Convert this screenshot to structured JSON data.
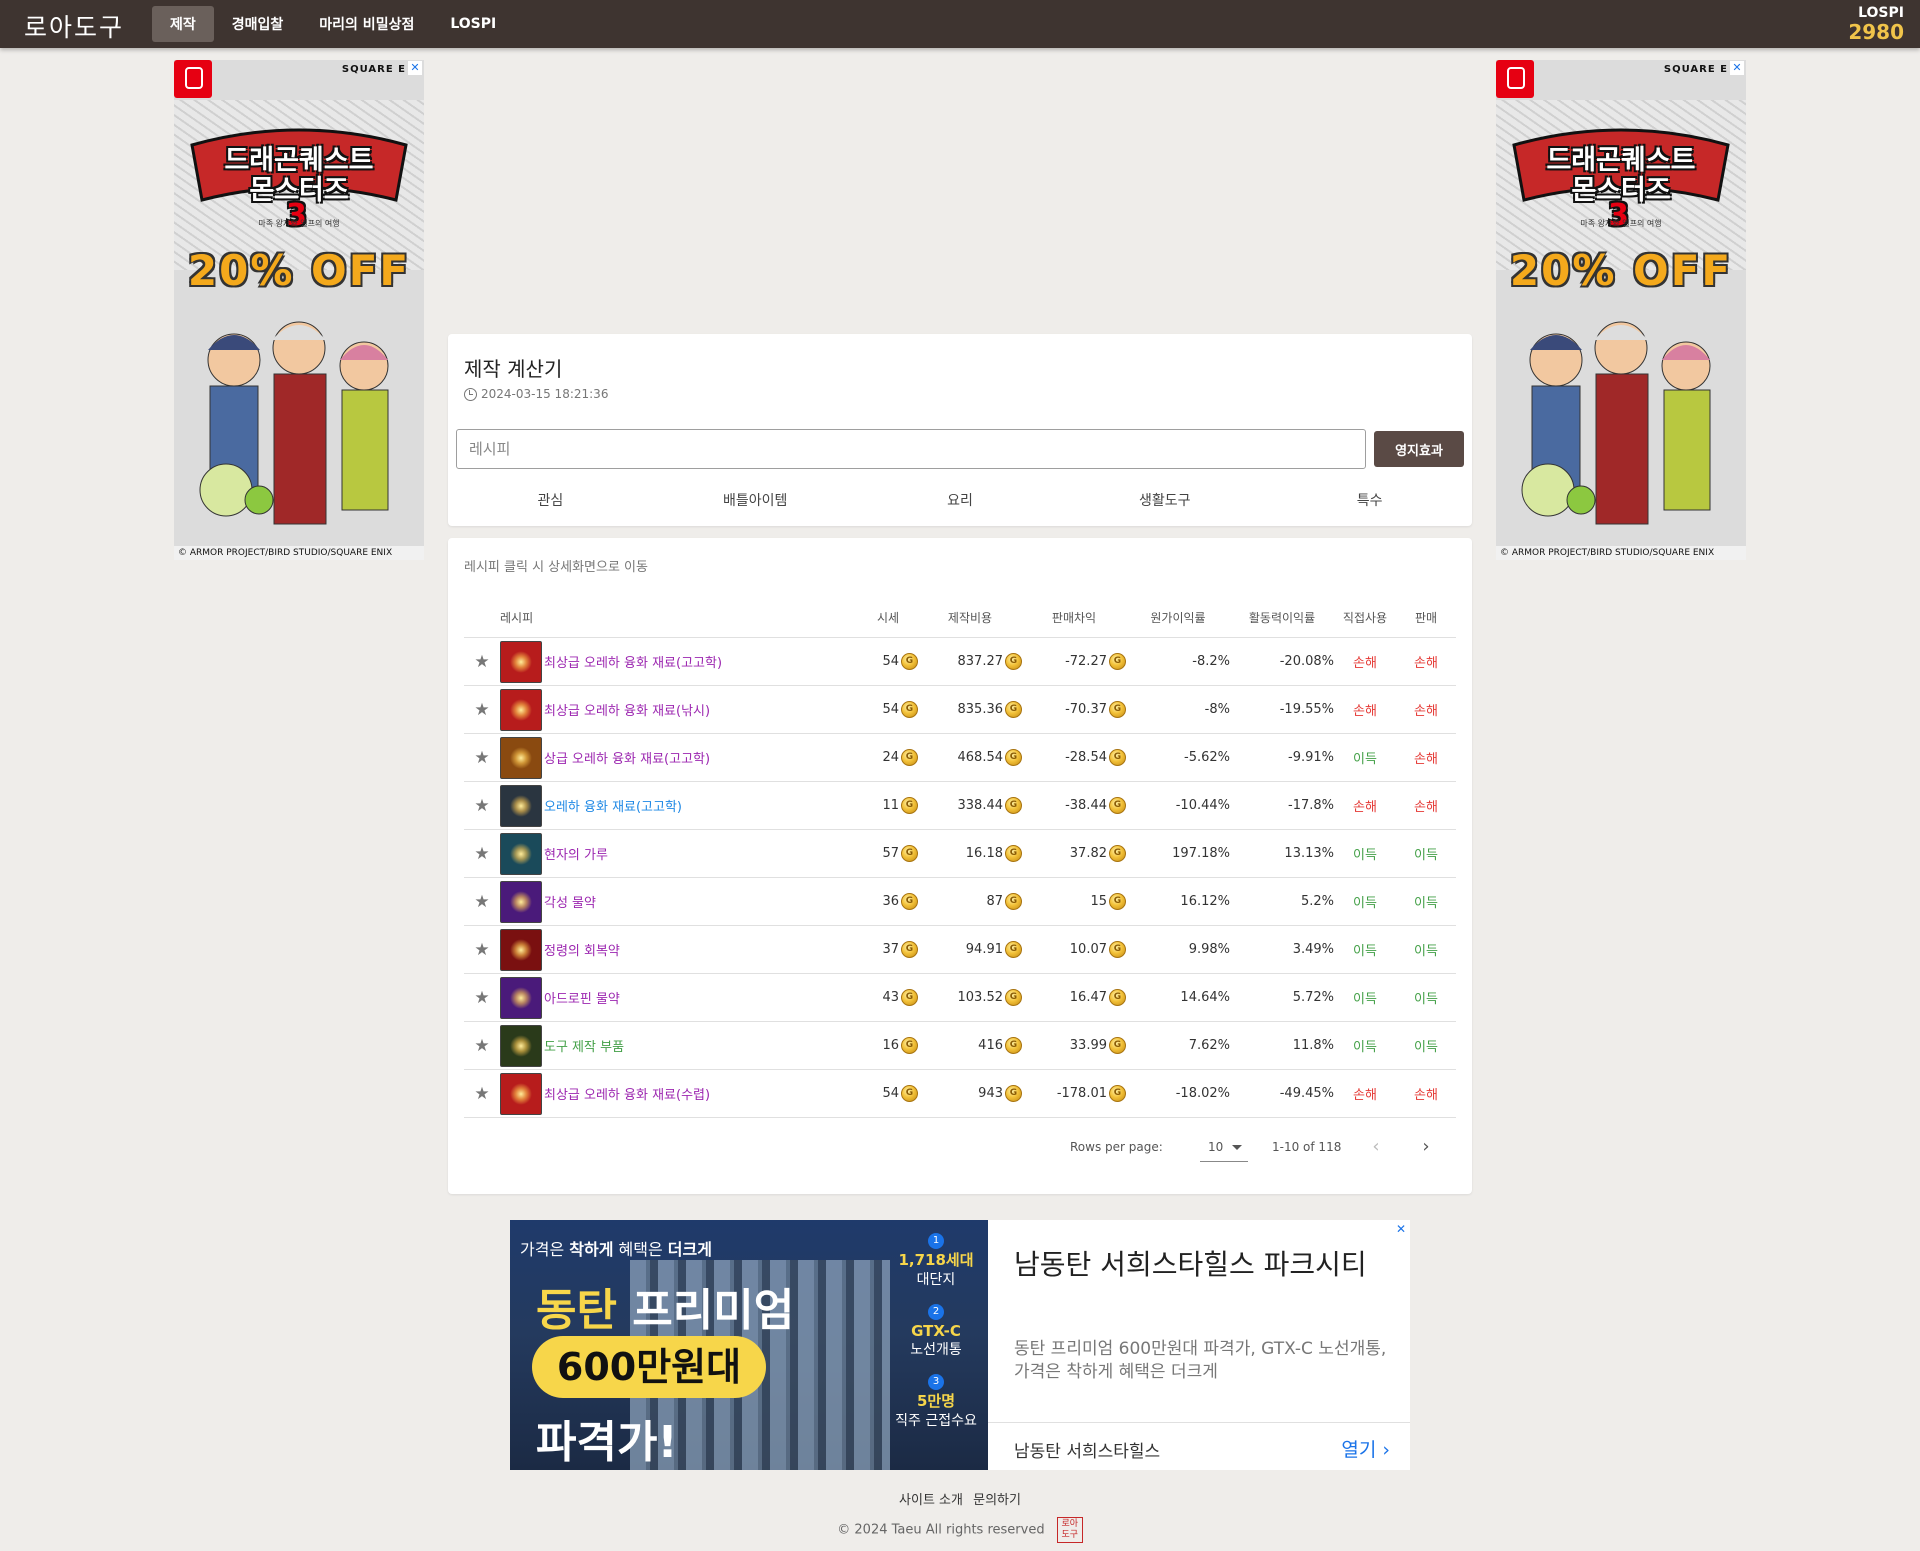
{
  "topbar": {
    "logo": "로아도구",
    "nav": [
      "제작",
      "경매입찰",
      "마리의 비밀상점",
      "LOSPI"
    ],
    "lospi_label": "LOSPI",
    "lospi_value": "2980"
  },
  "side_ad": {
    "brand": "SQUARE E",
    "title_line1": "드래곤퀘스트",
    "title_line2": "몬스터즈",
    "number": "3",
    "subtitle": "마족 왕자와 엘프의 여행",
    "offer": "20% OFF",
    "copyright": "© ARMOR PROJECT/BIRD STUDIO/SQUARE ENIX"
  },
  "calculator": {
    "title": "제작 계산기",
    "timestamp": "2024-03-15 18:21:36",
    "search_placeholder": "레시피",
    "territory_button": "영지효과",
    "tabs": [
      "관심",
      "배틀아이템",
      "요리",
      "생활도구",
      "특수"
    ]
  },
  "recipes": {
    "hint": "레시피 클릭 시 상세화면으로 이동",
    "headers": {
      "recipe": "레시피",
      "price": "시세",
      "cost": "제작비용",
      "diff": "판매차익",
      "orig_margin": "원가이익률",
      "act_margin": "활동력이익률",
      "direct": "직접사용",
      "sell": "판매"
    },
    "rows": [
      {
        "name": "최상급 오레하 융화 재료(고고학)",
        "price": "54",
        "cost": "837.27",
        "diff": "-72.27",
        "orig": "-8.2%",
        "act": "-20.08%",
        "direct": "손해",
        "sell": "손해",
        "name_color": "#9c27b0",
        "icon_color": "#b71c1c"
      },
      {
        "name": "최상급 오레하 융화 재료(낚시)",
        "price": "54",
        "cost": "835.36",
        "diff": "-70.37",
        "orig": "-8%",
        "act": "-19.55%",
        "direct": "손해",
        "sell": "손해",
        "name_color": "#9c27b0",
        "icon_color": "#b71c1c"
      },
      {
        "name": "상급 오레하 융화 재료(고고학)",
        "price": "24",
        "cost": "468.54",
        "diff": "-28.54",
        "orig": "-5.62%",
        "act": "-9.91%",
        "direct": "이득",
        "sell": "손해",
        "name_color": "#9c27b0",
        "icon_color": "#8a4a10"
      },
      {
        "name": "오레하 융화 재료(고고학)",
        "price": "11",
        "cost": "338.44",
        "diff": "-38.44",
        "orig": "-10.44%",
        "act": "-17.8%",
        "direct": "손해",
        "sell": "손해",
        "name_color": "#1e88e5",
        "icon_color": "#2a3540"
      },
      {
        "name": "현자의 가루",
        "price": "57",
        "cost": "16.18",
        "diff": "37.82",
        "orig": "197.18%",
        "act": "13.13%",
        "direct": "이득",
        "sell": "이득",
        "name_color": "#9c27b0",
        "icon_color": "#1a4a5a"
      },
      {
        "name": "각성 물약",
        "price": "36",
        "cost": "87",
        "diff": "15",
        "orig": "16.12%",
        "act": "5.2%",
        "direct": "이득",
        "sell": "이득",
        "name_color": "#9c27b0",
        "icon_color": "#4a1a7a"
      },
      {
        "name": "정령의 회복약",
        "price": "37",
        "cost": "94.91",
        "diff": "10.07",
        "orig": "9.98%",
        "act": "3.49%",
        "direct": "이득",
        "sell": "이득",
        "name_color": "#9c27b0",
        "icon_color": "#7a1010"
      },
      {
        "name": "아드로핀 물약",
        "price": "43",
        "cost": "103.52",
        "diff": "16.47",
        "orig": "14.64%",
        "act": "5.72%",
        "direct": "이득",
        "sell": "이득",
        "name_color": "#9c27b0",
        "icon_color": "#4a1a7a"
      },
      {
        "name": "도구 제작 부품",
        "price": "16",
        "cost": "416",
        "diff": "33.99",
        "orig": "7.62%",
        "act": "11.8%",
        "direct": "이득",
        "sell": "이득",
        "name_color": "#43a047",
        "icon_color": "#2a3a1a"
      },
      {
        "name": "최상급 오레하 융화 재료(수렵)",
        "price": "54",
        "cost": "943",
        "diff": "-178.01",
        "orig": "-18.02%",
        "act": "-49.45%",
        "direct": "손해",
        "sell": "손해",
        "name_color": "#9c27b0",
        "icon_color": "#b71c1c"
      }
    ],
    "pager": {
      "label": "Rows per page:",
      "rows_per_page": "10",
      "range": "1-10 of 118"
    }
  },
  "bottom_ad": {
    "tag_pre": "가격은",
    "tag_b1": "착하게",
    "tag_mid": "혜택은",
    "tag_b2": "더크게",
    "head1_a": "동탄",
    "head1_b": " 프리미엄",
    "pill": "600만원대",
    "head2": "파격가!",
    "features": [
      {
        "n": "1",
        "hl": "1,718세대",
        "txt": "대단지"
      },
      {
        "n": "2",
        "hl": "GTX-C",
        "txt": "노선개통"
      },
      {
        "n": "3",
        "hl": "5만명",
        "txt": "직주 근접수요"
      }
    ],
    "title": "남동탄 서희스타힐스 파크시티",
    "description": "동탄 프리미엄 600만원대 파격가, GTX-C 노선개통, 가격은 착하게 혜택은 더크게",
    "advertiser": "남동탄 서희스타힐스",
    "open": "열기"
  },
  "footer": {
    "about": "사이트 소개",
    "contact": "문의하기",
    "copyright": "© 2024 Taeu All rights reserved",
    "seal": "로아도구"
  },
  "colors": {
    "topbar": "#3e3430",
    "accent_gold": "#f0c44a",
    "button_brown": "#5a4a45",
    "loss": "#e53935",
    "gain": "#43a047"
  }
}
